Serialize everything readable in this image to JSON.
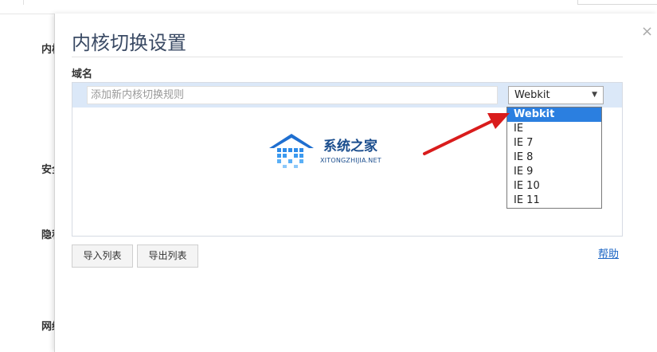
{
  "background": {
    "side_labels": [
      "内核",
      "安全",
      "隐私",
      "网络"
    ]
  },
  "dialog": {
    "title": "内核切换设置",
    "close_label": "×",
    "section_label": "域名",
    "rule_input": {
      "value": "",
      "placeholder": "添加新内核切换规则"
    },
    "engine_select": {
      "selected": "Webkit",
      "options": [
        "Webkit",
        "IE",
        "IE 7",
        "IE 8",
        "IE 9",
        "IE 10",
        "IE 11"
      ]
    },
    "buttons": {
      "import": "导入列表",
      "export": "导出列表",
      "help": "帮助"
    },
    "watermark": {
      "name": "系统之家",
      "domain": "XITONGZHIJIA.NET"
    }
  },
  "colors": {
    "accent": "#2b7fe0",
    "header_bg": "#dbe8f8",
    "title": "#3a4a64",
    "annotation_arrow": "#d91c1c"
  },
  "icons": {
    "select_arrow": "caret-down-icon",
    "close": "close-icon",
    "annotation": "red-arrow-icon"
  }
}
